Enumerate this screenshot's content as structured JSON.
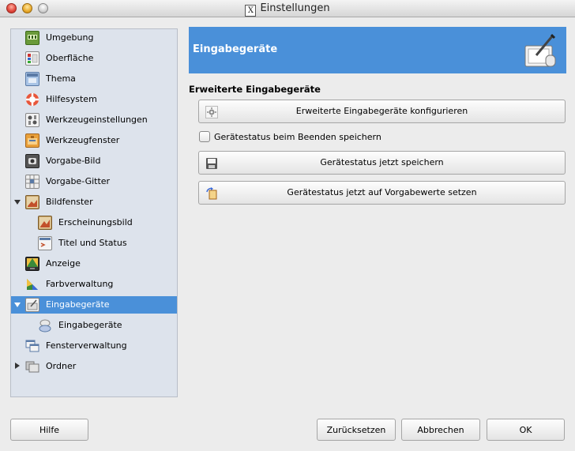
{
  "window": {
    "title": "Einstellungen"
  },
  "sidebar": {
    "items": [
      {
        "label": "Umgebung",
        "icon": "environment-icon"
      },
      {
        "label": "Oberfläche",
        "icon": "interface-icon"
      },
      {
        "label": "Thema",
        "icon": "theme-icon"
      },
      {
        "label": "Hilfesystem",
        "icon": "help-system-icon"
      },
      {
        "label": "Werkzeugeinstellungen",
        "icon": "tool-options-icon"
      },
      {
        "label": "Werkzeugfenster",
        "icon": "toolbox-icon"
      },
      {
        "label": "Vorgabe-Bild",
        "icon": "default-image-icon"
      },
      {
        "label": "Vorgabe-Gitter",
        "icon": "default-grid-icon"
      },
      {
        "label": "Bildfenster",
        "icon": "image-window-icon"
      },
      {
        "label": "Erscheinungsbild",
        "icon": "appearance-icon"
      },
      {
        "label": "Titel und Status",
        "icon": "title-status-icon"
      },
      {
        "label": "Anzeige",
        "icon": "display-icon"
      },
      {
        "label": "Farbverwaltung",
        "icon": "color-management-icon"
      },
      {
        "label": "Eingabegeräte",
        "icon": "input-devices-icon"
      },
      {
        "label": "Eingabegeräte",
        "icon": "input-controllers-icon"
      },
      {
        "label": "Fensterverwaltung",
        "icon": "window-management-icon"
      },
      {
        "label": "Ordner",
        "icon": "folders-icon"
      }
    ],
    "selected_index": 13
  },
  "main": {
    "header_title": "Eingabegeräte",
    "section_title": "Erweiterte Eingabegeräte",
    "configure_button": "Erweiterte Eingabegeräte konfigurieren",
    "save_on_exit_label": "Gerätestatus beim Beenden speichern",
    "save_on_exit_checked": false,
    "save_now_button": "Gerätestatus jetzt speichern",
    "reset_button": "Gerätestatus jetzt auf Vorgabewerte setzen"
  },
  "footer": {
    "help": "Hilfe",
    "reset": "Zurücksetzen",
    "cancel": "Abbrechen",
    "ok": "OK"
  },
  "colors": {
    "selection": "#4a90d9",
    "sidebar_bg": "#dde3ec",
    "window_bg": "#ececec"
  }
}
